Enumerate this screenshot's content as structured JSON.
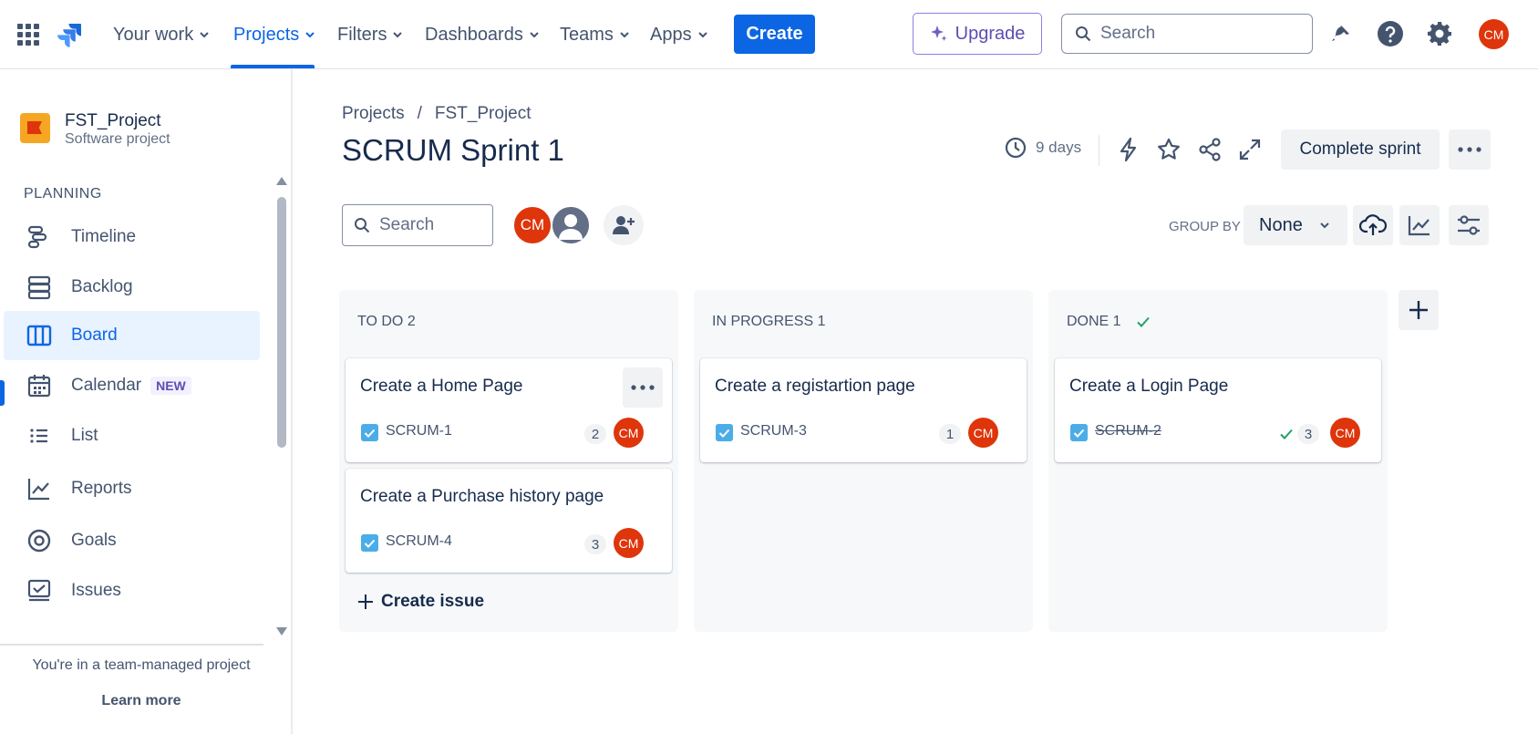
{
  "topnav": {
    "items": [
      {
        "label": "Your work"
      },
      {
        "label": "Projects"
      },
      {
        "label": "Filters"
      },
      {
        "label": "Dashboards"
      },
      {
        "label": "Teams"
      },
      {
        "label": "Apps"
      }
    ],
    "active_item": "Projects",
    "create_label": "Create",
    "upgrade_label": "Upgrade",
    "search_placeholder": "Search",
    "avatar_initials": "CM"
  },
  "sidebar": {
    "project_name": "FST_Project",
    "project_type": "Software project",
    "section_label": "PLANNING",
    "items": [
      {
        "label": "Timeline",
        "icon": "timeline-icon"
      },
      {
        "label": "Backlog",
        "icon": "backlog-icon"
      },
      {
        "label": "Board",
        "icon": "board-icon"
      },
      {
        "label": "Calendar",
        "icon": "calendar-icon",
        "badge": "NEW"
      },
      {
        "label": "List",
        "icon": "list-icon"
      },
      {
        "label": "Reports",
        "icon": "reports-icon"
      },
      {
        "label": "Goals",
        "icon": "goals-icon"
      },
      {
        "label": "Issues",
        "icon": "issues-icon"
      }
    ],
    "active_item": "Board",
    "footer_text": "You're in a team-managed project",
    "learn_more": "Learn more"
  },
  "header": {
    "breadcrumb": [
      "Projects",
      "FST_Project"
    ],
    "breadcrumb_separator": "/",
    "title": "SCRUM Sprint 1",
    "days_remaining": "9 days",
    "complete_sprint_label": "Complete sprint"
  },
  "toolbar": {
    "search_placeholder": "Search",
    "avatar_initials": "CM",
    "group_by_label": "GROUP BY",
    "group_by_value": "None"
  },
  "board": {
    "columns": [
      {
        "title": "TO DO 2",
        "cards": [
          {
            "title": "Create a Home Page",
            "key": "SCRUM-1",
            "points": "2",
            "assignee": "CM",
            "done": false
          },
          {
            "title": "Create a Purchase history page",
            "key": "SCRUM-4",
            "points": "3",
            "assignee": "CM",
            "done": false
          }
        ],
        "create_issue": "Create issue"
      },
      {
        "title": "IN PROGRESS 1",
        "cards": [
          {
            "title": "Create a registartion page",
            "key": "SCRUM-3",
            "points": "1",
            "assignee": "CM",
            "done": false
          }
        ]
      },
      {
        "title": "DONE 1",
        "cards": [
          {
            "title": "Create a Login Page",
            "key": "SCRUM-2",
            "points": "3",
            "assignee": "CM",
            "done": true
          }
        ]
      }
    ]
  },
  "colors": {
    "brand_blue": "#0c66e4",
    "avatar_red": "#de350b",
    "done_green": "#22a06b",
    "upgrade_purple": "#5e4db2"
  }
}
